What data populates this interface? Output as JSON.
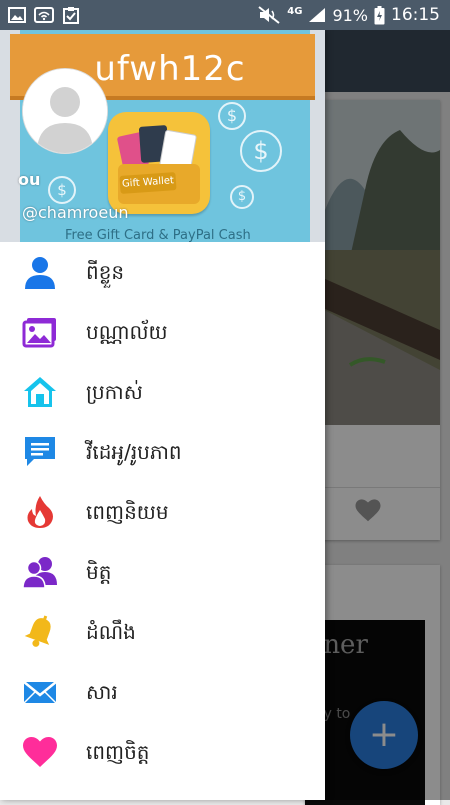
{
  "status_bar": {
    "network": "4G",
    "battery": "91%",
    "time": "16:15"
  },
  "drawer_header": {
    "banner_title": "ufwh12c",
    "banner_footer": "Free Gift Card & PayPal Cash",
    "wallet_label": "Gift Wallet",
    "user_name": "ou",
    "user_handle": "@chamroeun"
  },
  "menu": [
    {
      "label": "ពីខ្លួន",
      "icon": "person-icon",
      "color": "#1976e8"
    },
    {
      "label": "បណ្ណាល័យ",
      "icon": "gallery-icon",
      "color": "#8e2ad6"
    },
    {
      "label": "ប្រកាស់",
      "icon": "home-icon",
      "color": "#16c3ec"
    },
    {
      "label": "វីដេអូ/រូបភាព",
      "icon": "chat-icon",
      "color": "#1e88e5"
    },
    {
      "label": "ពេញនិយម",
      "icon": "fire-icon",
      "color": "#e53935"
    },
    {
      "label": "មិត្ត",
      "icon": "friends-icon",
      "color": "#7b28c8"
    },
    {
      "label": "ដំណឹង",
      "icon": "bell-icon",
      "color": "#f2b81a"
    },
    {
      "label": "សារ",
      "icon": "mail-icon",
      "color": "#1e88e5"
    },
    {
      "label": "ពេញចិត្ត",
      "icon": "heart-icon",
      "color": "#ff2d9a"
    }
  ],
  "background": {
    "card_text_1": "ıner",
    "card_text_2": "ay to",
    "fab_symbol": "+"
  }
}
